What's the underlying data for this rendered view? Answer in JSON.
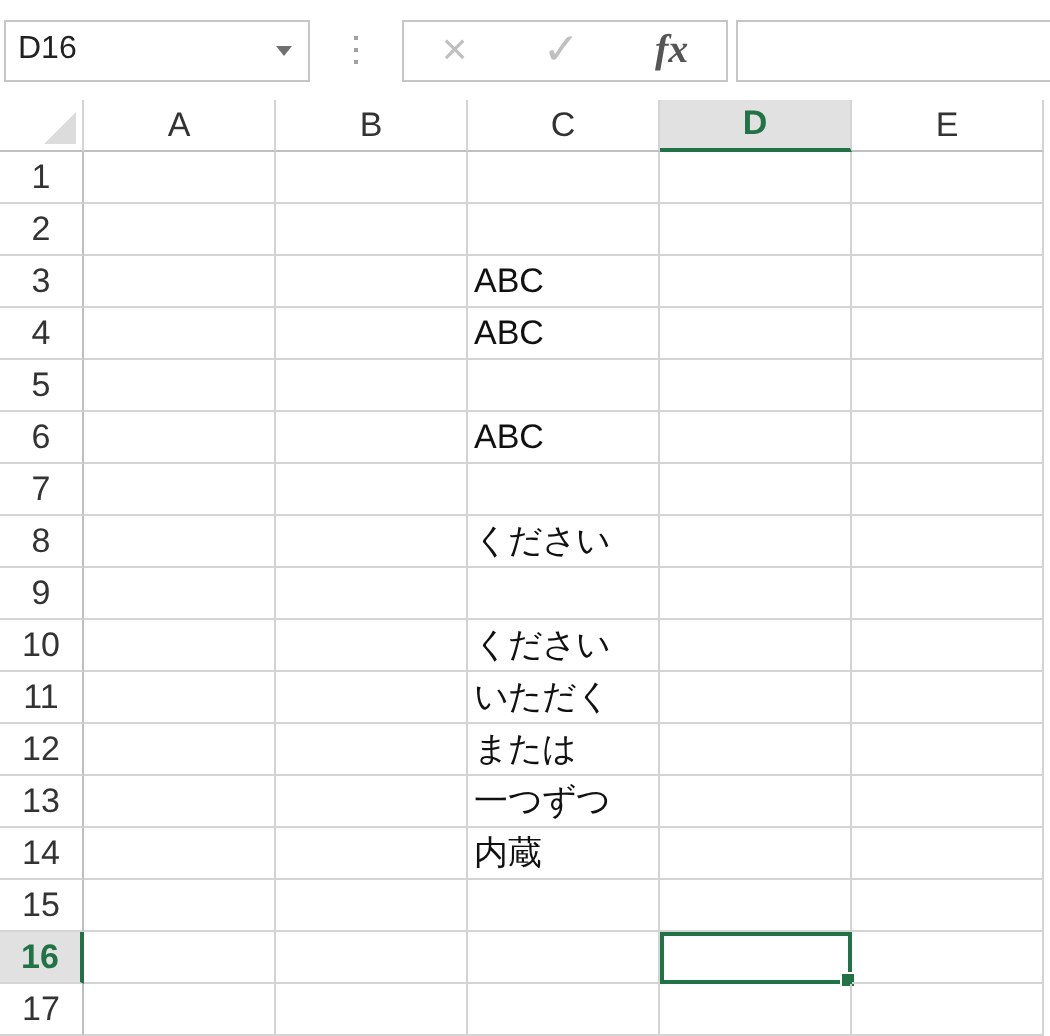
{
  "name_box": {
    "value": "D16"
  },
  "formula_bar": {
    "cancel": "×",
    "enter": "✓",
    "function": "fx"
  },
  "columns": [
    {
      "label": "A",
      "selected": false
    },
    {
      "label": "B",
      "selected": false
    },
    {
      "label": "C",
      "selected": false
    },
    {
      "label": "D",
      "selected": true
    },
    {
      "label": "E",
      "selected": false
    }
  ],
  "rows": [
    {
      "label": "1",
      "selected": false
    },
    {
      "label": "2",
      "selected": false
    },
    {
      "label": "3",
      "selected": false,
      "column_c": "ABC"
    },
    {
      "label": "4",
      "selected": false,
      "column_c": "ABC"
    },
    {
      "label": "5",
      "selected": false
    },
    {
      "label": "6",
      "selected": false,
      "column_c": "ABC"
    },
    {
      "label": "7",
      "selected": false
    },
    {
      "label": "8",
      "selected": false,
      "column_c": "ください"
    },
    {
      "label": "9",
      "selected": false
    },
    {
      "label": "10",
      "selected": false,
      "column_c": "ください"
    },
    {
      "label": "11",
      "selected": false,
      "column_c": "いただく"
    },
    {
      "label": "12",
      "selected": false,
      "column_c": "または"
    },
    {
      "label": "13",
      "selected": false,
      "column_c": "一つずつ"
    },
    {
      "label": "14",
      "selected": false,
      "column_c": "内蔵"
    },
    {
      "label": "15",
      "selected": false
    },
    {
      "label": "16",
      "selected": true
    },
    {
      "label": "17",
      "selected": false
    }
  ]
}
